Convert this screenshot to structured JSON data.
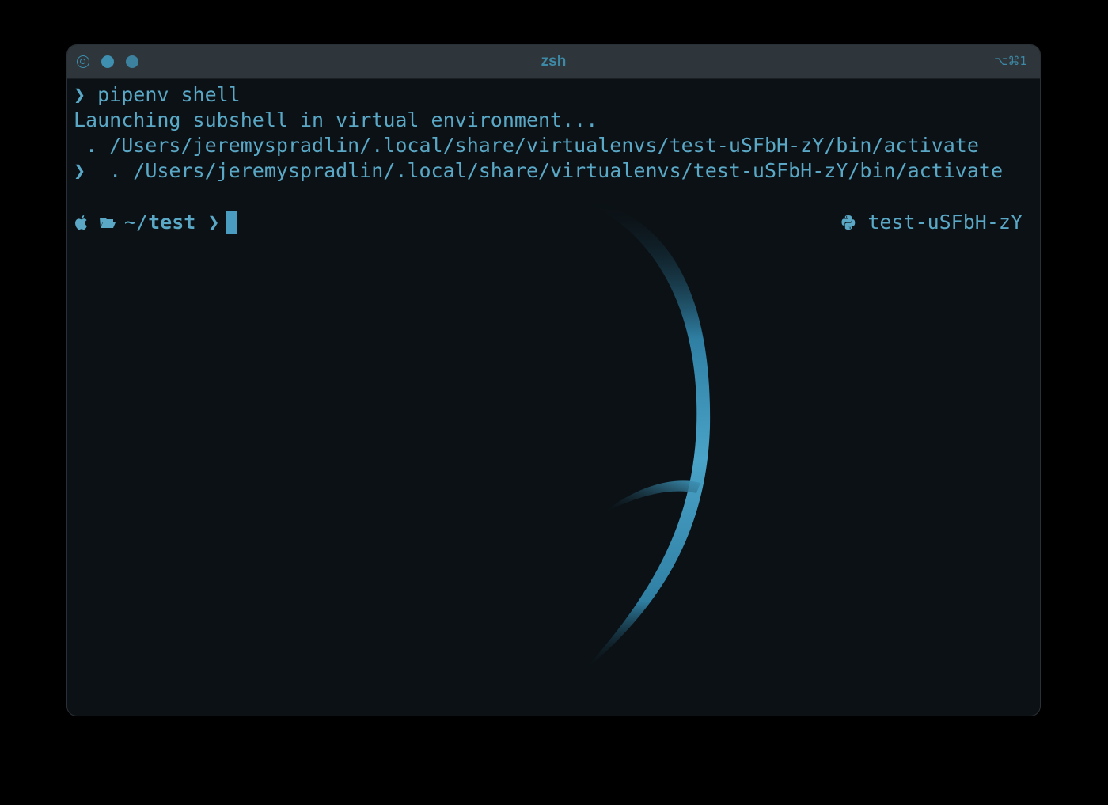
{
  "window": {
    "title": "zsh",
    "shortcut": "⌥⌘1"
  },
  "terminal": {
    "lines": [
      {
        "prompt": "❯",
        "text": " pipenv shell"
      },
      {
        "prompt": "",
        "text": "Launching subshell in virtual environment..."
      },
      {
        "prompt": "",
        "text": " . /Users/jeremyspradlin/.local/share/virtualenvs/test-uSFbH-zY/bin/activate"
      },
      {
        "prompt": "❯",
        "text": "  . /Users/jeremyspradlin/.local/share/virtualenvs/test-uSFbH-zY/bin/activate"
      }
    ],
    "prompt": {
      "os_icon": "apple-icon",
      "folder_icon": "folder-open-icon",
      "cwd_prefix": "~/",
      "cwd_name": "test",
      "arrow": "❯",
      "venv_icon": "python-icon",
      "venv_name": "test-uSFbH-zY"
    }
  },
  "colors": {
    "accent": "#5aa8c6",
    "background": "#0b1115",
    "titlebar": "#2f363b"
  }
}
